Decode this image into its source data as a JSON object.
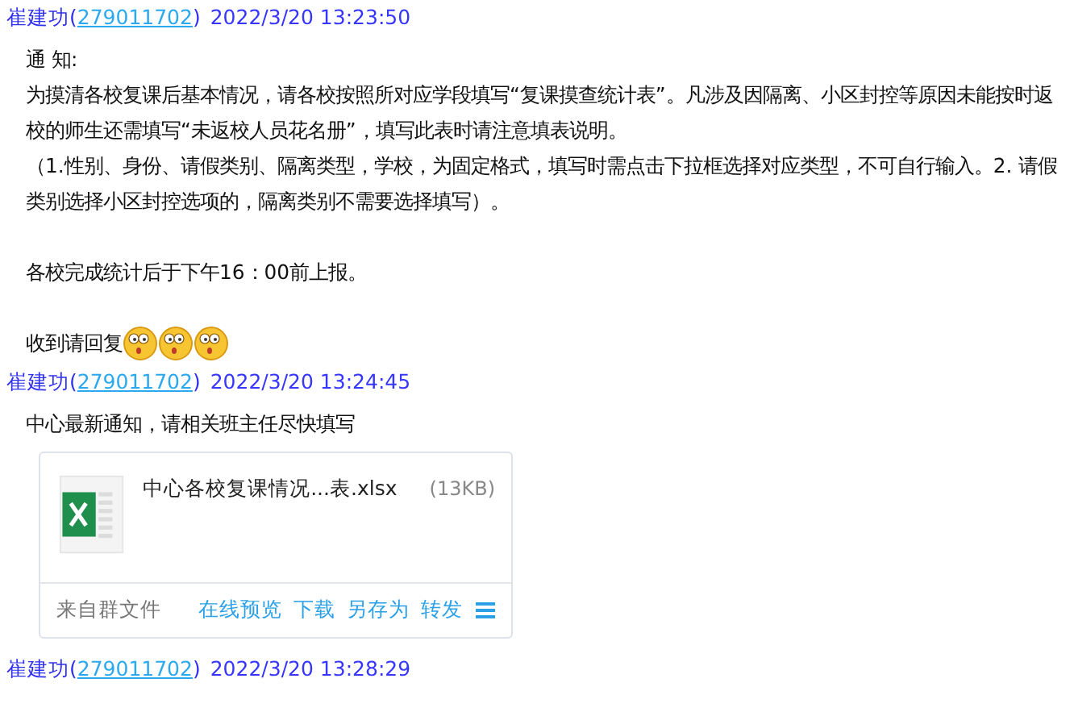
{
  "paren_open": "(",
  "paren_close": ")",
  "messages": [
    {
      "sender": "崔建功",
      "qq": "279011702",
      "time": "2022/3/20 13:23:50",
      "blocks": [
        [
          {
            "text": "通 知:"
          },
          {
            "text": "为摸清各校复课后基本情况，请各校按照所对应学段填写“复课摸查统计表”。凡涉及因隔离、小区封控等原因未能按时返校的师生还需填写“未返校人员花名册”，填写此表时请注意填表说明。"
          },
          {
            "text": "（1.性别、身份、请假类别、隔离类型，学校，为固定格式，填写时需点击下拉框选择对应类型，不可自行输入。2. 请假类别选择小区封控选项的，隔离类别不需要选择填写）。"
          }
        ],
        [
          {
            "text": "各校完成统计后于下午16：00前上报。"
          }
        ],
        [
          {
            "text": "收到请回复",
            "emojis": [
              {
                "kind": "surprised"
              },
              {
                "kind": "surprised"
              },
              {
                "kind": "surprised"
              }
            ]
          }
        ]
      ]
    },
    {
      "sender": "崔建功",
      "qq": "279011702",
      "time": "2022/3/20 13:24:45",
      "blocks": [
        [
          {
            "text": "中心最新通知，请相关班主任尽快填写"
          }
        ]
      ],
      "file": {
        "name": "中心各校复课情况...表.xlsx",
        "size": "(13KB)",
        "source": "来自群文件",
        "actions": [
          "在线预览",
          "下载",
          "另存为",
          "转发"
        ]
      }
    },
    {
      "sender": "崔建功",
      "qq": "279011702",
      "time": "2022/3/20 13:28:29"
    }
  ]
}
